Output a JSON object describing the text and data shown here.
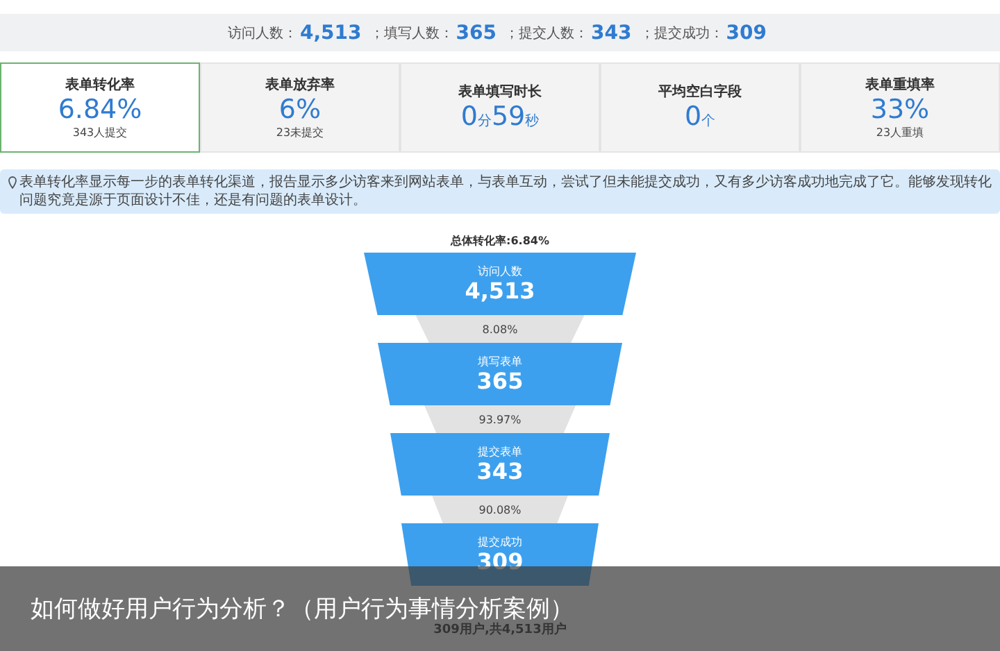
{
  "summary": [
    {
      "label": "访问人数：",
      "value": "4,513"
    },
    {
      "label": "；填写人数：",
      "value": "365"
    },
    {
      "label": "；提交人数：",
      "value": "343"
    },
    {
      "label": "；提交成功：",
      "value": "309"
    }
  ],
  "cards": [
    {
      "title": "表单转化率",
      "selected": true,
      "value_parts": [
        {
          "text": "6.84%",
          "kind": "number"
        }
      ],
      "note": "343人提交"
    },
    {
      "title": "表单放弃率",
      "selected": false,
      "value_parts": [
        {
          "text": "6%",
          "kind": "number"
        }
      ],
      "note": "23未提交"
    },
    {
      "title": "表单填写时长",
      "selected": false,
      "value_parts": [
        {
          "text": "0",
          "kind": "number"
        },
        {
          "text": "分",
          "kind": "unit"
        },
        {
          "text": "59",
          "kind": "number"
        },
        {
          "text": "秒",
          "kind": "unit"
        }
      ]
    },
    {
      "title": "平均空白字段",
      "selected": false,
      "value_parts": [
        {
          "text": "0",
          "kind": "number"
        },
        {
          "text": "个",
          "kind": "unit"
        }
      ]
    },
    {
      "title": "表单重填率",
      "selected": false,
      "value_parts": [
        {
          "text": "33%",
          "kind": "number"
        }
      ],
      "note": "23人重填"
    }
  ],
  "info": "表单转化率显示每一步的表单转化渠道，报告显示多少访客来到网站表单，与表单互动，尝试了但未能提交成功，又有多少访客成功地完成了它。能够发现转化问题究竟是源于页面设计不佳，还是有问题的表单设计。",
  "funnel": {
    "title": "总体转化率:6.84%",
    "stages": [
      {
        "label": "访问人数",
        "value": "4,513",
        "rate": "8.08%"
      },
      {
        "label": "填写表单",
        "value": "365",
        "rate": "93.97%"
      },
      {
        "label": "提交表单",
        "value": "343",
        "rate": "90.08%"
      },
      {
        "label": "提交成功",
        "value": "309"
      }
    ],
    "footer": "309用户,共4,513用户"
  },
  "caption": "如何做好用户行为分析？（用户行为事情分析案例）"
}
